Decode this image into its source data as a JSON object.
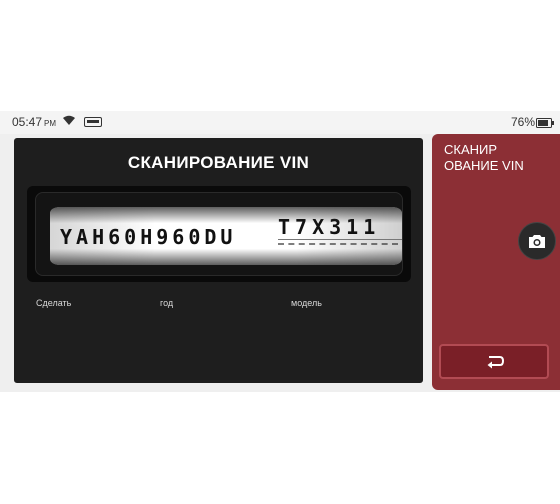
{
  "status_bar": {
    "time": "05:47",
    "ampm": "PM",
    "battery_percent": "76%",
    "icons": [
      "wifi-icon",
      "sd-card-icon",
      "battery-icon"
    ]
  },
  "vin_panel": {
    "title": "СКАНИРОВАНИЕ VIN",
    "vin_main": "YAH60H960DU",
    "vin_tail": "T7X311",
    "labels": {
      "make": "Сделать",
      "year": "год",
      "model": "модель"
    }
  },
  "side_panel": {
    "title_line1": "СКАНИР",
    "title_line2": "ОВАНИЕ VIN",
    "camera_icon": "camera-icon",
    "back_icon": "back-icon"
  },
  "colors": {
    "panel_bg": "#1e1e1e",
    "side_bg": "#8c2f35",
    "back_btn": "#7a1f27"
  }
}
